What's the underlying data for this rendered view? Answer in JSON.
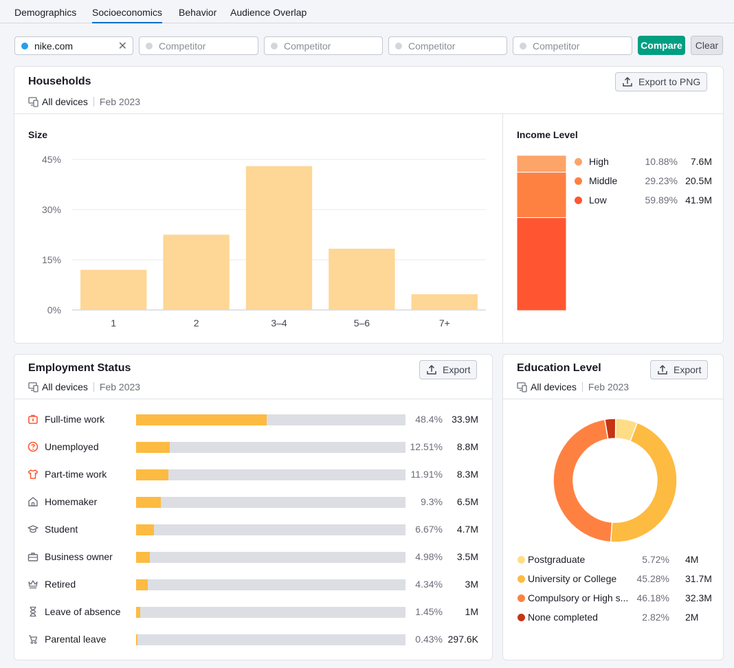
{
  "tabs": [
    "Demographics",
    "Socioeconomics",
    "Behavior",
    "Audience Overlap"
  ],
  "active_tab": "Socioeconomics",
  "compare_bar": {
    "primary": {
      "value": "nike.com",
      "dot_color": "#2b9eea"
    },
    "competitor_placeholder": "Competitor",
    "compare_label": "Compare",
    "clear_label": "Clear"
  },
  "households": {
    "title": "Households",
    "devices": "All devices",
    "date": "Feb 2023",
    "export_label": "Export to PNG",
    "size": {
      "title": "Size",
      "chart_data": {
        "type": "bar",
        "categories": [
          "1",
          "2",
          "3–4",
          "5–6",
          "7+"
        ],
        "values": [
          12,
          22.5,
          43,
          18.3,
          4.7
        ],
        "yticks": [
          "0%",
          "15%",
          "30%",
          "45%"
        ],
        "ylim": [
          0,
          45
        ],
        "bar_color": "#fed695"
      }
    },
    "income": {
      "title": "Income Level",
      "items": [
        {
          "label": "High",
          "pct": "10.88%",
          "value": "7.6M",
          "share": 10.88,
          "color": "#fda469"
        },
        {
          "label": "Middle",
          "pct": "29.23%",
          "value": "20.5M",
          "share": 29.23,
          "color": "#ff8142"
        },
        {
          "label": "Low",
          "pct": "59.89%",
          "value": "41.9M",
          "share": 59.89,
          "color": "#ff5631"
        }
      ]
    }
  },
  "employment": {
    "title": "Employment Status",
    "devices": "All devices",
    "date": "Feb 2023",
    "export_label": "Export",
    "bar_color": "#fdbb41",
    "items": [
      {
        "label": "Full-time work",
        "pct": "48.4%",
        "value": "33.9M",
        "share": 48.4,
        "icon": "briefcase-icon"
      },
      {
        "label": "Unemployed",
        "pct": "12.51%",
        "value": "8.8M",
        "share": 12.51,
        "icon": "question-circle-icon"
      },
      {
        "label": "Part-time work",
        "pct": "11.91%",
        "value": "8.3M",
        "share": 11.91,
        "icon": "shirt-icon"
      },
      {
        "label": "Homemaker",
        "pct": "9.3%",
        "value": "6.5M",
        "share": 9.3,
        "icon": "home-icon"
      },
      {
        "label": "Student",
        "pct": "6.67%",
        "value": "4.7M",
        "share": 6.67,
        "icon": "graduation-cap-icon"
      },
      {
        "label": "Business owner",
        "pct": "4.98%",
        "value": "3.5M",
        "share": 4.98,
        "icon": "case-icon"
      },
      {
        "label": "Retired",
        "pct": "4.34%",
        "value": "3M",
        "share": 4.34,
        "icon": "crown-icon"
      },
      {
        "label": "Leave of absence",
        "pct": "1.45%",
        "value": "1M",
        "share": 1.45,
        "icon": "hourglass-icon"
      },
      {
        "label": "Parental leave",
        "pct": "0.43%",
        "value": "297.6K",
        "share": 0.43,
        "icon": "stroller-icon"
      }
    ]
  },
  "education": {
    "title": "Education Level",
    "devices": "All devices",
    "date": "Feb 2023",
    "export_label": "Export",
    "items": [
      {
        "label": "Postgraduate",
        "pct": "5.72%",
        "value": "4M",
        "share": 5.72,
        "color": "#fedd86"
      },
      {
        "label": "University or College",
        "pct": "45.28%",
        "value": "31.7M",
        "share": 45.28,
        "color": "#fdbb41"
      },
      {
        "label": "Compulsory or High s...",
        "pct": "46.18%",
        "value": "32.3M",
        "share": 46.18,
        "color": "#ff8142"
      },
      {
        "label": "None completed",
        "pct": "2.82%",
        "value": "2M",
        "share": 2.82,
        "color": "#c63514"
      }
    ]
  }
}
